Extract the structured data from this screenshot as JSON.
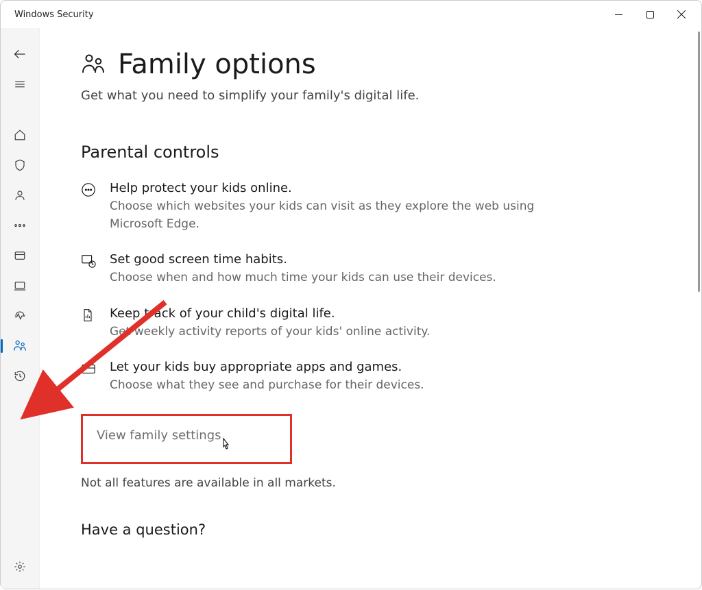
{
  "window": {
    "title": "Windows Security"
  },
  "page": {
    "title": "Family options",
    "subtitle": "Get what you need to simplify your family's digital life."
  },
  "section": {
    "parental_controls": "Parental controls",
    "have_question": "Have a question?"
  },
  "features": [
    {
      "title": "Help protect your kids online.",
      "desc": "Choose which websites your kids can visit as they explore the web using Microsoft Edge."
    },
    {
      "title": "Set good screen time habits.",
      "desc": "Choose when and how much time your kids can use their devices."
    },
    {
      "title": "Keep track of your child's digital life.",
      "desc": "Get weekly activity reports of your kids' online activity."
    },
    {
      "title": "Let your kids buy appropriate apps and games.",
      "desc": "Choose what they see and purchase for their devices."
    }
  ],
  "link": {
    "view_family_settings": "View family settings"
  },
  "disclaimer": "Not all features are available in all markets."
}
